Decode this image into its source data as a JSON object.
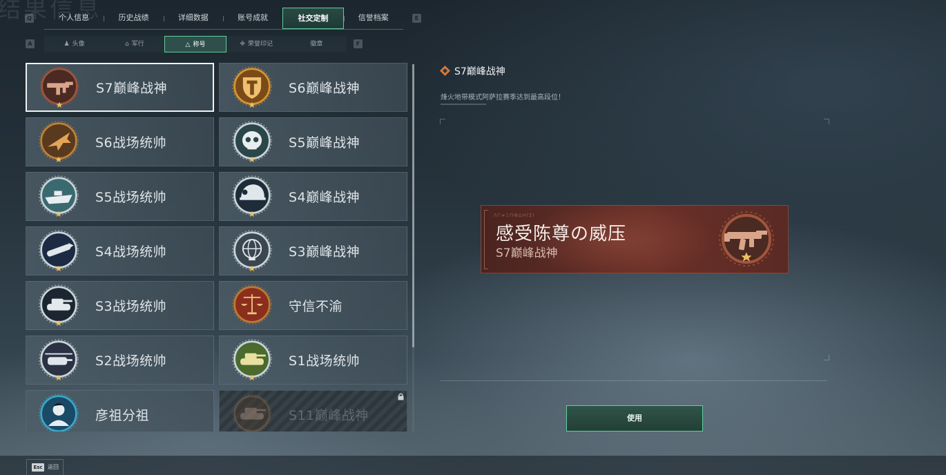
{
  "page": {
    "bg_title": "结果信息"
  },
  "key_hints": {
    "left": "Q",
    "right": "E",
    "sub_left": "A",
    "sub_right": "F"
  },
  "top_tabs": [
    {
      "label": "个人信息"
    },
    {
      "label": "历史战绩"
    },
    {
      "label": "详细数据"
    },
    {
      "label": "账号成就"
    },
    {
      "label": "社交定制",
      "active": true
    },
    {
      "label": "信誉档案"
    }
  ],
  "sub_tabs": [
    {
      "label": "头像",
      "icon": "person-icon",
      "glyph": "♟"
    },
    {
      "label": "军行",
      "icon": "insignia-icon",
      "glyph": "⌂"
    },
    {
      "label": "称号",
      "icon": "title-icon",
      "glyph": "△",
      "active": true
    },
    {
      "label": "荣誉印记",
      "icon": "mark-icon",
      "glyph": "✙"
    },
    {
      "label": "徽章",
      "icon": "",
      "glyph": ""
    }
  ],
  "titles": [
    {
      "name": "S7巅峰战神",
      "medal": "rifle-medal",
      "rim": "#a0553c",
      "fill": "#4a2a22",
      "symbol": "#d9a58a",
      "star": true,
      "selected": true
    },
    {
      "name": "S6巅峰战神",
      "medal": "shield-medal",
      "rim": "#d9952e",
      "fill": "#7a4a18",
      "symbol": "#f0c070",
      "star": true
    },
    {
      "name": "S6战场统帅",
      "medal": "jet-medal",
      "rim": "#c08038",
      "fill": "#5a3a1e",
      "symbol": "#e3a55a",
      "star": true
    },
    {
      "name": "S5巅峰战神",
      "medal": "skull-medal",
      "rim": "#c9d4d8",
      "fill": "#2a4648",
      "symbol": "#e8eef0",
      "star": true
    },
    {
      "name": "S5战场统帅",
      "medal": "ship-medal",
      "rim": "#c9d4d8",
      "fill": "#3a6a70",
      "symbol": "#e8eef0",
      "star": true
    },
    {
      "name": "S4巅峰战神",
      "medal": "helmet-medal",
      "rim": "#c9d4d8",
      "fill": "#1e2c3a",
      "symbol": "#dfe7ea",
      "star": true
    },
    {
      "name": "S4战场统帅",
      "medal": "missile-medal",
      "rim": "#c9d4d8",
      "fill": "#1c2a44",
      "symbol": "#dfe7ea",
      "star": true
    },
    {
      "name": "S3巅峰战神",
      "medal": "globe-medal",
      "rim": "#c9d4d8",
      "fill": "#3a4650",
      "symbol": "#e3e9ec",
      "star": true
    },
    {
      "name": "S3战场统帅",
      "medal": "tank-medal",
      "rim": "#c9d4d8",
      "fill": "#1c2630",
      "symbol": "#e3e9ec",
      "star": true
    },
    {
      "name": "守信不渝",
      "medal": "scales-medal",
      "rim": "#c07a30",
      "fill": "#8a2e1e",
      "symbol": "#f0c27a",
      "star": false
    },
    {
      "name": "S2战场统帅",
      "medal": "helicopter-medal",
      "rim": "#c9d4d8",
      "fill": "#2a3244",
      "symbol": "#dfe5ea",
      "star": true
    },
    {
      "name": "S1战场统帅",
      "medal": "tank-medal",
      "rim": "#c9d4d8",
      "fill": "#4a6a2e",
      "symbol": "#e8e0a0",
      "star": true
    },
    {
      "name": "彦祖分祖",
      "medal": "portrait-medal",
      "rim": "#3aa7c9",
      "fill": "#1a4a66",
      "symbol": "#e6edf0",
      "star": false
    },
    {
      "name": "S11巅峰战神",
      "medal": "tank-medal",
      "rim": "#8a6a4a",
      "fill": "#4a3a2a",
      "symbol": "#b8957a",
      "star": false,
      "locked": true
    }
  ],
  "detail": {
    "title": "S7巅峰战神",
    "description": "烽火地带模式阿萨拉赛季达到最高段位！",
    "banner_code": "ΛΓ≠ΞΠΦΔНİΣӀ",
    "banner_main": "感受陈尊の威压",
    "banner_sub": "S7巅峰战神",
    "use_label": "使用"
  },
  "footer": {
    "esc_key": "Esc",
    "esc_label": "返回"
  },
  "colors": {
    "accent": "#5fcf9f",
    "banner": "#6a3028"
  }
}
